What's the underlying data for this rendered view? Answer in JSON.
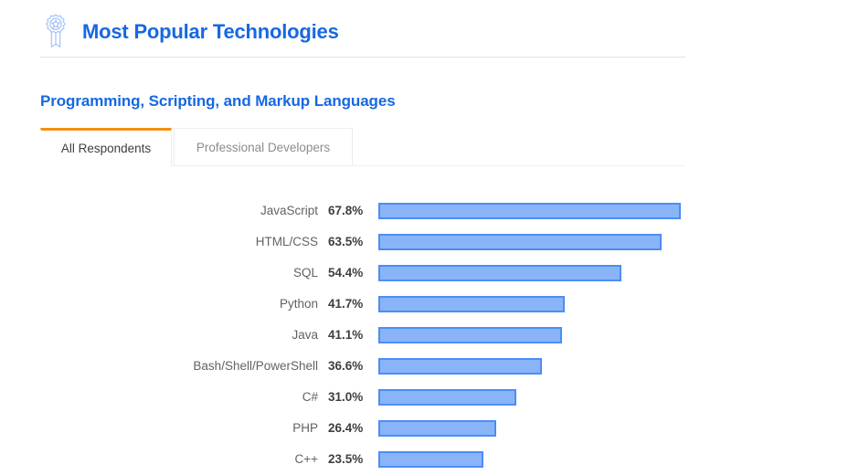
{
  "header": {
    "icon": "award-ribbon-icon",
    "title": "Most Popular Technologies"
  },
  "section": {
    "title": "Programming, Scripting, and Markup Languages"
  },
  "tabs": [
    {
      "label": "All Respondents",
      "active": true
    },
    {
      "label": "Professional Developers",
      "active": false
    }
  ],
  "colors": {
    "title_blue": "#1668e3",
    "bar_fill": "#8ab4f8",
    "bar_border": "#4b8df8",
    "active_tab_accent": "#f29111",
    "divider": "#e2e2e2"
  },
  "chart_data": {
    "type": "bar",
    "orientation": "horizontal",
    "title": "Programming, Scripting, and Markup Languages",
    "xlabel": "",
    "ylabel": "",
    "xlim": [
      0,
      100
    ],
    "grid": false,
    "legend": "none",
    "value_suffix": "%",
    "categories": [
      "JavaScript",
      "HTML/CSS",
      "SQL",
      "Python",
      "Java",
      "Bash/Shell/PowerShell",
      "C#",
      "PHP",
      "C++"
    ],
    "values": [
      67.8,
      63.5,
      54.4,
      41.7,
      41.1,
      36.6,
      31.0,
      26.4,
      23.5
    ],
    "value_labels": [
      "67.8%",
      "63.5%",
      "54.4%",
      "41.7%",
      "41.1%",
      "36.6%",
      "31.0%",
      "26.4%",
      "23.5%"
    ]
  }
}
